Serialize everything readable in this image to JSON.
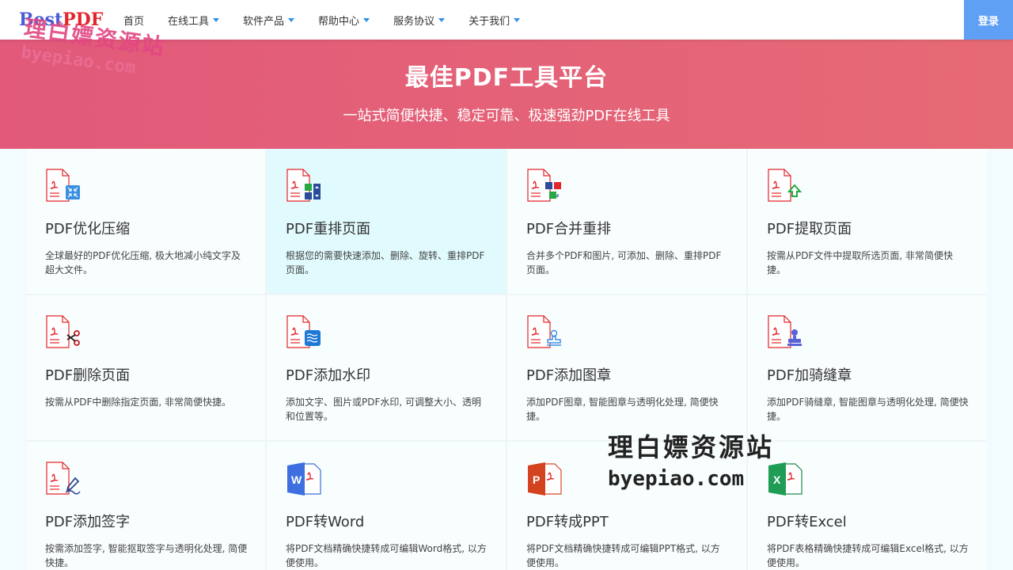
{
  "header": {
    "logo_part1": "Best",
    "logo_part2": "PDF",
    "nav": [
      {
        "label": "首页",
        "dropdown": false
      },
      {
        "label": "在线工具",
        "dropdown": true
      },
      {
        "label": "软件产品",
        "dropdown": true
      },
      {
        "label": "帮助中心",
        "dropdown": true
      },
      {
        "label": "服务协议",
        "dropdown": true
      },
      {
        "label": "关于我们",
        "dropdown": true
      }
    ],
    "login_label": "登录"
  },
  "hero": {
    "title": "最佳PDF工具平台",
    "subtitle": "一站式简便快捷、稳定可靠、极速强劲PDF在线工具"
  },
  "watermark": {
    "text_cn": "理白嫖资源站",
    "text_en": "byepiao.com"
  },
  "tools": [
    {
      "title": "PDF优化压缩",
      "desc": "全球最好的PDF优化压缩, 极大地减小纯文字及超大文件。",
      "icon": "pdf-compress-icon"
    },
    {
      "title": "PDF重排页面",
      "desc": "根据您的需要快速添加、删除、旋转、重排PDF页面。",
      "icon": "pdf-reorder-icon"
    },
    {
      "title": "PDF合并重排",
      "desc": "合并多个PDF和图片, 可添加、删除、重排PDF页面。",
      "icon": "pdf-merge-icon"
    },
    {
      "title": "PDF提取页面",
      "desc": "按需从PDF文件中提取所选页面, 非常简便快捷。",
      "icon": "pdf-extract-icon"
    },
    {
      "title": "PDF删除页面",
      "desc": "按需从PDF中删除指定页面, 非常简便快捷。",
      "icon": "pdf-delete-icon"
    },
    {
      "title": "PDF添加水印",
      "desc": "添加文字、图片或PDF水印, 可调整大小、透明和位置等。",
      "icon": "pdf-watermark-icon"
    },
    {
      "title": "PDF添加图章",
      "desc": "添加PDF图章, 智能图章与透明化处理, 简便快捷。",
      "icon": "pdf-stamp-icon"
    },
    {
      "title": "PDF加骑缝章",
      "desc": "添加PDF骑缝章, 智能图章与透明化处理, 简便快捷。",
      "icon": "pdf-seal-icon"
    },
    {
      "title": "PDF添加签字",
      "desc": "按需添加签字, 智能抠取签字与透明化处理, 简便快捷。",
      "icon": "pdf-sign-icon"
    },
    {
      "title": "PDF转Word",
      "desc": "将PDF文档精确快捷转成可编辑Word格式, 以方便使用。",
      "icon": "pdf-to-word-icon"
    },
    {
      "title": "PDF转成PPT",
      "desc": "将PDF文档精确快捷转成可编辑PPT格式, 以方便使用。",
      "icon": "pdf-to-ppt-icon"
    },
    {
      "title": "PDF转Excel",
      "desc": "将PDF表格精确快捷转成可编辑Excel格式, 以方便使用。",
      "icon": "pdf-to-excel-icon"
    }
  ],
  "colors": {
    "accent": "#5fa0f5",
    "hero": "#e2597a",
    "pdf_red": "#e3262b"
  }
}
